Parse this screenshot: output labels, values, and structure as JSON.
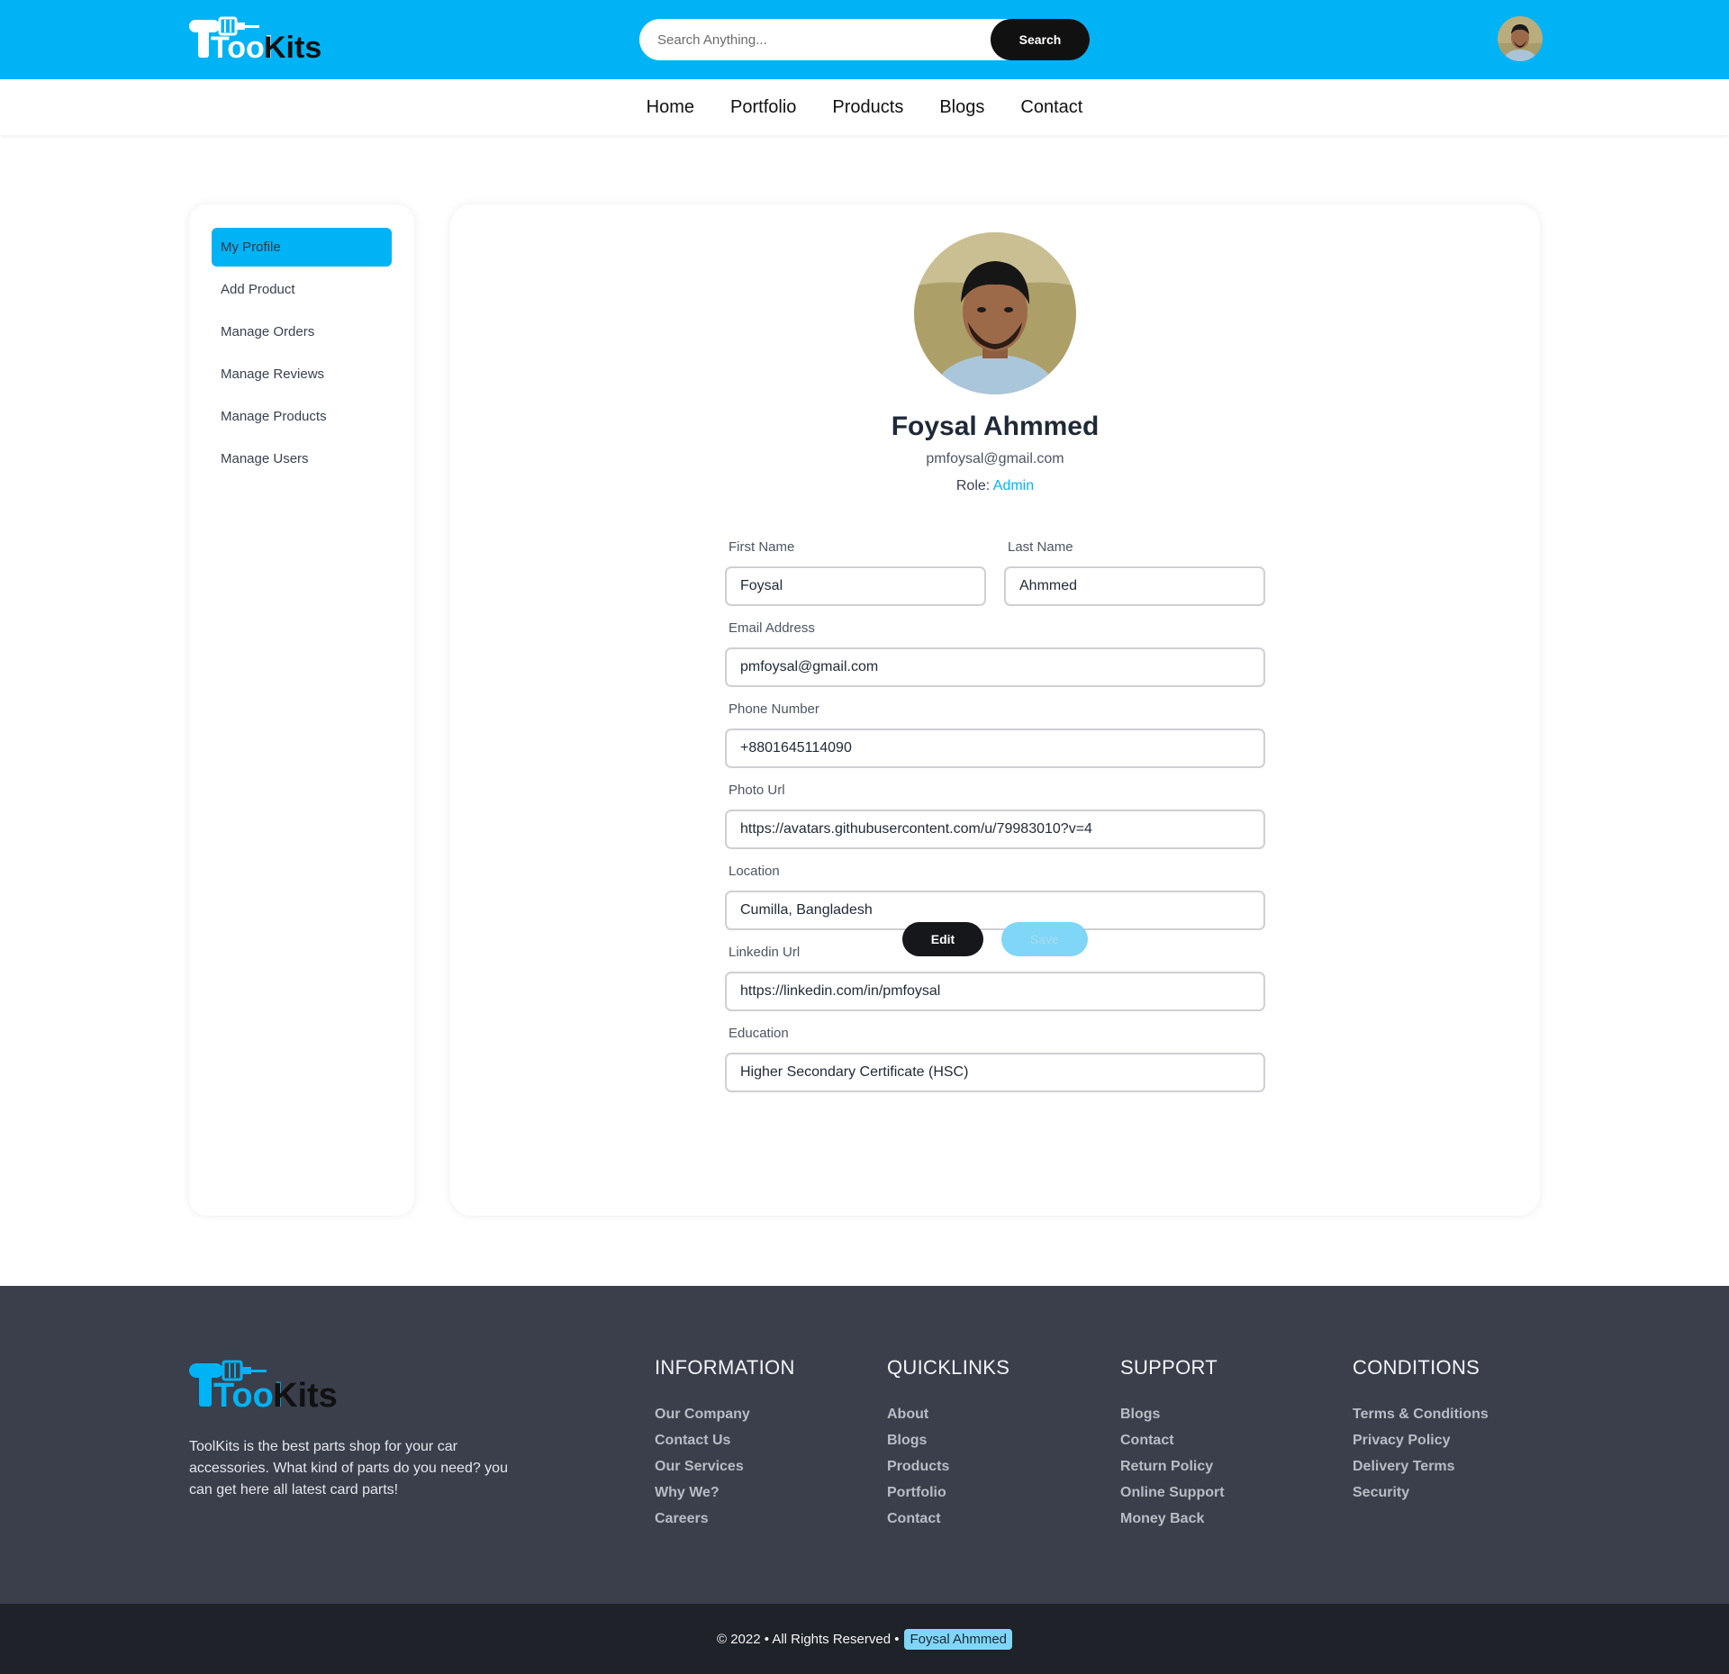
{
  "brand": {
    "name_part1": "Tool",
    "name_part2": "Kits",
    "accent_color": "#00b3f5",
    "dark_color": "#15171b"
  },
  "header": {
    "search_placeholder": "Search Anything...",
    "search_button": "Search",
    "avatar_icon": "user-avatar"
  },
  "nav": {
    "items": [
      "Home",
      "Portfolio",
      "Products",
      "Blogs",
      "Contact"
    ]
  },
  "sidebar": {
    "items": [
      "My Profile",
      "Add Product",
      "Manage Orders",
      "Manage Reviews",
      "Manage Products",
      "Manage Users"
    ],
    "active": "My Profile"
  },
  "profile": {
    "name": "Foysal Ahmmed",
    "email": "pmfoysal@gmail.com",
    "role_label": "Role:",
    "role_value": "Admin"
  },
  "form": {
    "first_name": {
      "label": "First Name",
      "value": "Foysal"
    },
    "last_name": {
      "label": "Last Name",
      "value": "Ahmmed"
    },
    "email": {
      "label": "Email Address",
      "value": "pmfoysal@gmail.com"
    },
    "phone": {
      "label": "Phone Number",
      "value": "+8801645114090"
    },
    "photo_url": {
      "label": "Photo Url",
      "value": "https://avatars.githubusercontent.com/u/79983010?v=4"
    },
    "location": {
      "label": "Location",
      "value": "Cumilla, Bangladesh"
    },
    "linkedin": {
      "label": "Linkedin Url",
      "value": "https://linkedin.com/in/pmfoysal"
    },
    "education": {
      "label": "Education",
      "value": "Higher Secondary Certificate (HSC)"
    },
    "edit_button": "Edit",
    "save_button": "Save"
  },
  "footer": {
    "description": "ToolKits is the best parts shop for your car accessories. What kind of parts do you need? you can get here all latest card parts!",
    "columns": [
      {
        "title": "INFORMATION",
        "links": [
          "Our Company",
          "Contact Us",
          "Our Services",
          "Why We?",
          "Careers"
        ]
      },
      {
        "title": "QUICKLINKS",
        "links": [
          "About",
          "Blogs",
          "Products",
          "Portfolio",
          "Contact"
        ]
      },
      {
        "title": "SUPPORT",
        "links": [
          "Blogs",
          "Contact",
          "Return Policy",
          "Online Support",
          "Money Back"
        ]
      },
      {
        "title": "CONDITIONS",
        "links": [
          "Terms & Conditions",
          "Privacy Policy",
          "Delivery Terms",
          "Security"
        ]
      }
    ],
    "copyright": "© 2022 • All Rights Reserved •",
    "author": "Foysal Ahmmed"
  }
}
